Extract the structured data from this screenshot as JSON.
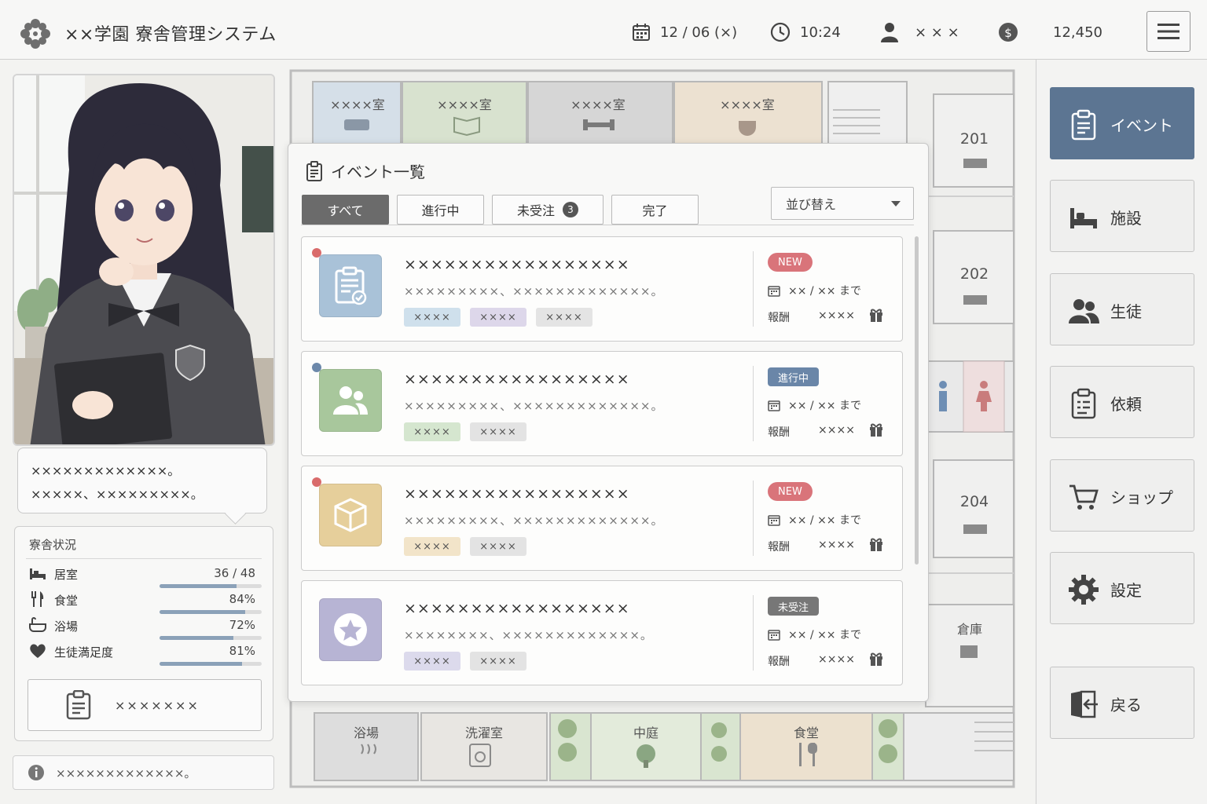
{
  "app": {
    "title": "××学園 寮舎管理システム",
    "logo_icon": "flower-crest-icon"
  },
  "topbar": {
    "date": "12 / 06 (×)",
    "time": "10:24",
    "user": "× × ×",
    "money": "12,450",
    "date_icon": "calendar-icon",
    "time_icon": "clock-icon",
    "user_icon": "user-icon",
    "money_icon": "coin-icon",
    "menu_icon": "hamburger-menu-icon"
  },
  "map": {
    "top_rooms": [
      "××××室",
      "××××室",
      "××××室",
      "××××室"
    ],
    "right_rooms": [
      "201",
      "202",
      "204",
      "倉庫"
    ],
    "bottom_rooms": [
      "浴場",
      "洗濯室",
      "中庭",
      "食堂"
    ]
  },
  "character": {
    "speech_line1": "×××××××××××××。",
    "speech_line2": "×××××、×××××××××。"
  },
  "dorm_status": {
    "title": "寮舎状況",
    "rows": [
      {
        "label": "居室",
        "value": "36 / 48",
        "ratio": 0.75,
        "icon": "bed-icon"
      },
      {
        "label": "食堂",
        "value": "84%",
        "ratio": 0.84,
        "icon": "fork-knife-icon"
      },
      {
        "label": "浴場",
        "value": "72%",
        "ratio": 0.72,
        "icon": "bathtub-icon"
      },
      {
        "label": "生徒満足度",
        "value": "81%",
        "ratio": 0.81,
        "icon": "heart-icon"
      }
    ],
    "button_label": "×××××××",
    "button_icon": "clipboard-icon"
  },
  "info_bar": {
    "text": "×××××××××××××。",
    "icon": "info-icon"
  },
  "nav": [
    {
      "label": "イベント",
      "icon": "clipboard-icon",
      "active": true
    },
    {
      "label": "施設",
      "icon": "bed-icon",
      "active": false
    },
    {
      "label": "生徒",
      "icon": "people-icon",
      "active": false
    },
    {
      "label": "依頼",
      "icon": "request-clipboard-icon",
      "active": false
    },
    {
      "label": "ショップ",
      "icon": "cart-icon",
      "active": false
    },
    {
      "label": "設定",
      "icon": "gear-icon",
      "active": false
    },
    {
      "label": "戻る",
      "icon": "exit-door-icon",
      "active": false
    }
  ],
  "events_modal": {
    "title": "イベント一覧",
    "tabs": [
      {
        "label": "すべて",
        "active": true
      },
      {
        "label": "進行中",
        "active": false
      },
      {
        "label": "未受注",
        "active": false,
        "badge": "3"
      },
      {
        "label": "完了",
        "active": false
      }
    ],
    "sort_label": "並び替え",
    "due_text": "×× / ×× まで",
    "reward_label": "報酬",
    "reward_value": "××××",
    "events": [
      {
        "title": "×××××××××××××××××",
        "desc": "×××××××××、×××××××××××××。",
        "tags": [
          "××××",
          "××××",
          "××××"
        ],
        "status": "NEW",
        "dot_color": "#d96b6b",
        "thumb_icon": "clipboard-check-icon",
        "thumb_color": "#a9c2d8",
        "tag_colors": [
          "#cfe0ec",
          "#ddd7ea",
          "#e4e4e4"
        ],
        "status_color": "#d9747a"
      },
      {
        "title": "×××××××××××××××××",
        "desc": "×××××××××、×××××××××××××。",
        "tags": [
          "××××",
          "××××"
        ],
        "status": "進行中",
        "dot_color": "#6c88aa",
        "thumb_icon": "people-icon",
        "thumb_color": "#a8c79c",
        "tag_colors": [
          "#d5e6cf",
          "#e3e3e3"
        ],
        "status_color": "#6a86a8"
      },
      {
        "title": "×××××××××××××××××",
        "desc": "×××××××××、×××××××××××××。",
        "tags": [
          "××××",
          "××××"
        ],
        "status": "NEW",
        "dot_color": "#d96b6b",
        "thumb_icon": "box-icon",
        "thumb_color": "#e6cf9b",
        "tag_colors": [
          "#f2e4c9",
          "#e3e3e3"
        ],
        "status_color": "#d9747a"
      },
      {
        "title": "×××××××××××××××××",
        "desc": "××××××××、×××××××××××××。",
        "tags": [
          "××××",
          "××××"
        ],
        "status": "未受注",
        "dot_color": "",
        "thumb_icon": "star-badge-icon",
        "thumb_color": "#b7b4d4",
        "tag_colors": [
          "#dcdaec",
          "#e3e3e3"
        ],
        "status_color": "#777777"
      }
    ]
  }
}
